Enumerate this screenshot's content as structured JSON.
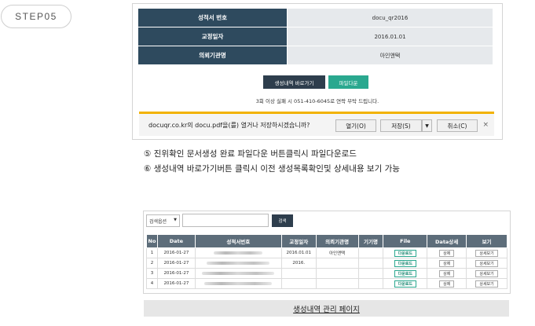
{
  "step_badge": "STEP05",
  "certificate_info": {
    "rows": [
      {
        "label": "성적서 번호",
        "value": "docu_qr2016"
      },
      {
        "label": "교정일자",
        "value": "2016.01.01"
      },
      {
        "label": "의뢰기관명",
        "value": "아인앤택"
      }
    ]
  },
  "buttons": {
    "history": "생성내역 바로가기",
    "download": "파일다운"
  },
  "notice": "3회 이상 실패 시 051-410-6045로 연락 부탁 드립니다.",
  "download_bar": {
    "message": "docuqr.co.kr의 docu.pdf을(를) 열거나 저장하시겠습니까?",
    "open": "열기(O)",
    "save": "저장(S)",
    "save_arrow": "▼",
    "cancel": "취소(C)",
    "close": "×"
  },
  "descriptions": [
    "⑤ 진위확인 문서생성 완료 파일다운 버튼클릭시 파일다운로드",
    "⑥ 생성내역 바로가기버튼 클릭시 이전 생성목록확인및 상세내용 보기 가능"
  ],
  "list_screen": {
    "search_select": "검색옵션",
    "search_select_arrow": "▼",
    "search_button": "검색",
    "columns": [
      "No",
      "Date",
      "성적서번호",
      "교정일자",
      "의뢰기관명",
      "기기명",
      "File",
      "Data상세",
      "보기"
    ],
    "rows": [
      {
        "no": "1",
        "date": "2016-01-27",
        "cal_date": "2016.01.01",
        "org": "아인앤택",
        "file": "다운로드",
        "detail": "상제",
        "view": "상세보기"
      },
      {
        "no": "2",
        "date": "2016-01-27",
        "cal_date": "2016.",
        "org": "",
        "file": "다운로드",
        "detail": "상제",
        "view": "상세보기"
      },
      {
        "no": "3",
        "date": "2016-01-27",
        "cal_date": "",
        "org": "",
        "file": "다운로드",
        "detail": "상제",
        "view": "상세보기"
      },
      {
        "no": "4",
        "date": "2016-01-27",
        "cal_date": "",
        "org": "",
        "file": "다운로드",
        "detail": "상제",
        "view": "상세보기"
      }
    ]
  },
  "caption": "생성내역 관리 페이지"
}
